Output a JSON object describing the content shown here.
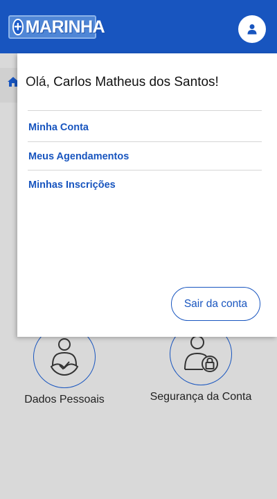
{
  "header": {
    "logo_text": "MARINHA",
    "logo_plus": "+",
    "user_icon": "user-icon",
    "background_color": "#1855bf"
  },
  "background": {
    "home_icon": "home-icon",
    "tiles": [
      {
        "label": "Dados Pessoais",
        "icon": "person-heart-icon"
      },
      {
        "label": "Segurança da Conta",
        "icon": "person-lock-icon"
      }
    ]
  },
  "panel": {
    "greeting_prefix": "Olá,",
    "user_name": "Carlos Matheus dos Santos!",
    "menu": [
      {
        "label": "Minha Conta"
      },
      {
        "label": "Meus Agendamentos"
      },
      {
        "label": "Minhas Inscrições"
      }
    ],
    "logout_label": "Sair da conta"
  },
  "colors": {
    "accent": "#1855bf",
    "backdrop": "#d9d9d9"
  }
}
